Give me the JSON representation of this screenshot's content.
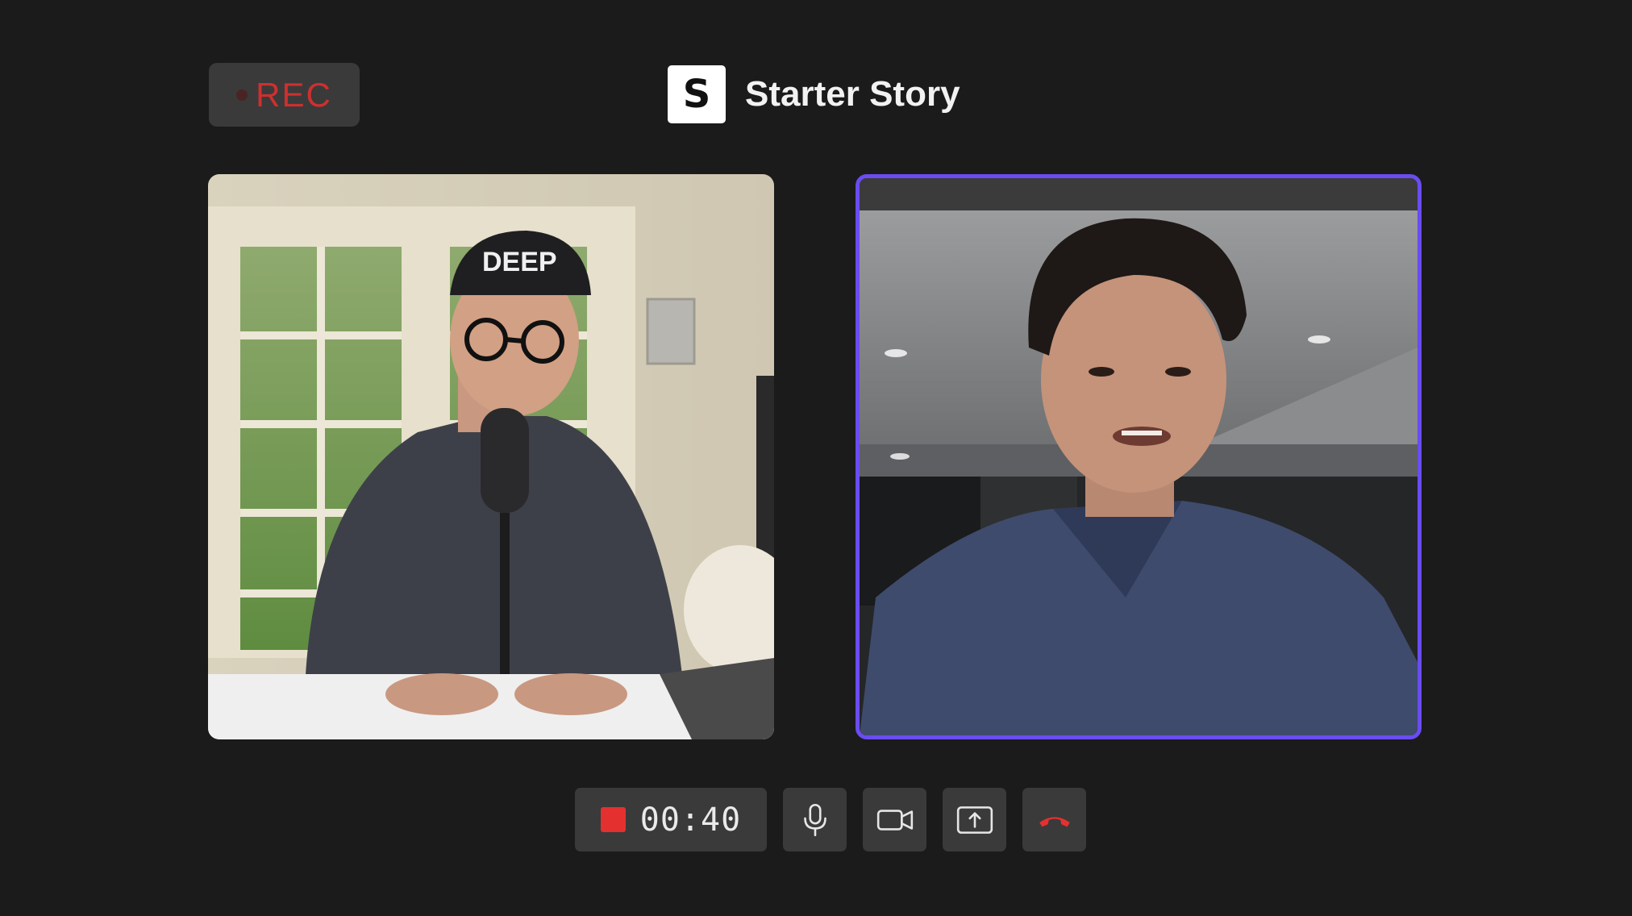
{
  "recording": {
    "label": "REC",
    "label_color": "#cf2f2f"
  },
  "brand": {
    "logo_letter": "S",
    "name": "Starter Story"
  },
  "participants": [
    {
      "icon": "video-feed-host",
      "active_speaker": false
    },
    {
      "icon": "video-feed-guest",
      "active_speaker": true,
      "highlight_color": "#6a4cf0"
    }
  ],
  "controls": {
    "timer": "00:40",
    "record_stop_color": "#e53030",
    "buttons": [
      {
        "icon": "microphone-icon"
      },
      {
        "icon": "camera-icon"
      },
      {
        "icon": "share-screen-icon"
      },
      {
        "icon": "end-call-icon",
        "color": "#e53030"
      }
    ]
  }
}
